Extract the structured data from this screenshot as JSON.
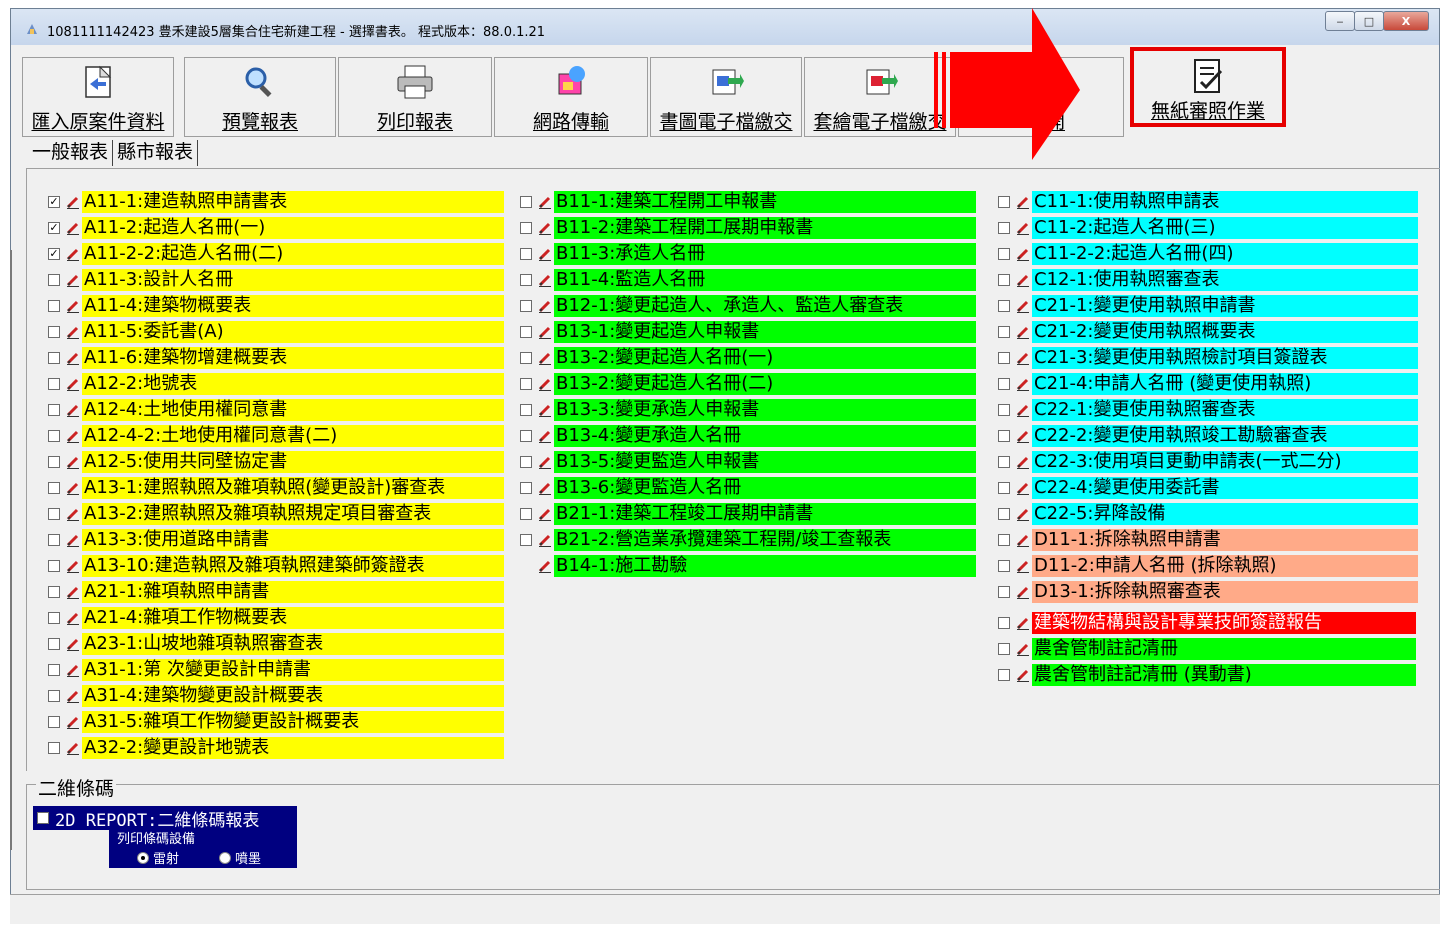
{
  "window": {
    "title": "1081111142423 豊禾建設5層集合住宅新建工程 - 選擇書表。  程式版本：88.0.1.21",
    "minimize": "‒",
    "maximize": "□",
    "close": "X"
  },
  "toolbar": [
    {
      "label": "匯入原案件資料"
    },
    {
      "label": "預覽報表"
    },
    {
      "label": "列印報表"
    },
    {
      "label": "網路傳輸"
    },
    {
      "label": "書圖電子檔繳交"
    },
    {
      "label": "套繪電子檔繳交"
    },
    {
      "label": "開"
    },
    {
      "label": "無紙審照作業"
    }
  ],
  "tabs": [
    "一般報表",
    "縣市報表"
  ],
  "columns": {
    "a": [
      {
        "label": "A11-1:建造執照申請書表",
        "checked": true
      },
      {
        "label": "A11-2:起造人名冊(一)",
        "checked": true
      },
      {
        "label": "A11-2-2:起造人名冊(二)",
        "checked": true
      },
      {
        "label": "A11-3:設計人名冊",
        "checked": false
      },
      {
        "label": "A11-4:建築物概要表",
        "checked": false
      },
      {
        "label": "A11-5:委託書(A)",
        "checked": false
      },
      {
        "label": "A11-6:建築物增建概要表",
        "checked": false
      },
      {
        "label": "A12-2:地號表",
        "checked": false
      },
      {
        "label": "A12-4:土地使用權同意書",
        "checked": false
      },
      {
        "label": "A12-4-2:土地使用權同意書(二)",
        "checked": false
      },
      {
        "label": "A12-5:使用共同壁協定書",
        "checked": false
      },
      {
        "label": "A13-1:建照執照及雜項執照(變更設計)審查表",
        "checked": false
      },
      {
        "label": "A13-2:建照執照及雜項執照規定項目審查表",
        "checked": false
      },
      {
        "label": "A13-3:使用道路申請書",
        "checked": false
      },
      {
        "label": "A13-10:建造執照及雜項執照建築師簽證表",
        "checked": false
      },
      {
        "label": "A21-1:雜項執照申請書",
        "checked": false
      },
      {
        "label": "A21-4:雜項工作物概要表",
        "checked": false
      },
      {
        "label": "A23-1:山坡地雜項執照審查表",
        "checked": false
      },
      {
        "label": "A31-1:第 次變更設計申請書",
        "checked": false
      },
      {
        "label": "A31-4:建築物變更設計概要表",
        "checked": false
      },
      {
        "label": "A31-5:雜項工作物變更設計概要表",
        "checked": false
      },
      {
        "label": "A32-2:變更設計地號表",
        "checked": false
      }
    ],
    "b": [
      {
        "label": "B11-1:建築工程開工申報書",
        "checkbox": true
      },
      {
        "label": "B11-2:建築工程開工展期申報書",
        "checkbox": true
      },
      {
        "label": "B11-3:承造人名冊",
        "checkbox": true
      },
      {
        "label": "B11-4:監造人名冊",
        "checkbox": true
      },
      {
        "label": "B12-1:變更起造人、承造人、監造人審查表",
        "checkbox": true
      },
      {
        "label": "B13-1:變更起造人申報書",
        "checkbox": true
      },
      {
        "label": "B13-2:變更起造人名冊(一)",
        "checkbox": true
      },
      {
        "label": "B13-2:變更起造人名冊(二)",
        "checkbox": true
      },
      {
        "label": "B13-3:變更承造人申報書",
        "checkbox": true
      },
      {
        "label": "B13-4:變更承造人名冊",
        "checkbox": true
      },
      {
        "label": "B13-5:變更監造人申報書",
        "checkbox": true
      },
      {
        "label": "B13-6:變更監造人名冊",
        "checkbox": true
      },
      {
        "label": "B21-1:建築工程竣工展期申請書",
        "checkbox": true
      },
      {
        "label": "B21-2:營造業承攬建築工程開/竣工查報表",
        "checkbox": true
      },
      {
        "label": "B14-1:施工勘驗",
        "checkbox": false
      }
    ],
    "c": [
      {
        "label": "C11-1:使用執照申請表",
        "color": "c"
      },
      {
        "label": "C11-2:起造人名冊(三)",
        "color": "c"
      },
      {
        "label": "C11-2-2:起造人名冊(四)",
        "color": "c"
      },
      {
        "label": "C12-1:使用執照審查表",
        "color": "c"
      },
      {
        "label": "C21-1:變更使用執照申請書",
        "color": "c"
      },
      {
        "label": "C21-2:變更使用執照概要表",
        "color": "c"
      },
      {
        "label": "C21-3:變更使用執照檢討項目簽證表",
        "color": "c"
      },
      {
        "label": "C21-4:申請人名冊 (變更使用執照)",
        "color": "c"
      },
      {
        "label": "C22-1:變更使用執照審查表",
        "color": "c"
      },
      {
        "label": "C22-2:變更使用執照竣工勘驗審查表",
        "color": "c"
      },
      {
        "label": "C22-3:使用項目更動申請表(一式二分)",
        "color": "c"
      },
      {
        "label": "C22-4:變更使用委託書",
        "color": "c"
      },
      {
        "label": "C22-5:昇降設備",
        "color": "c"
      },
      {
        "label": "D11-1:拆除執照申請書",
        "color": "s"
      },
      {
        "label": "D11-2:申請人名冊 (拆除執照)",
        "color": "s"
      },
      {
        "label": "D13-1:拆除執照審查表",
        "color": "s"
      }
    ],
    "extra": [
      {
        "label": "建築物結構與設計專業技師簽證報告",
        "color": "r"
      },
      {
        "label": "農舍管制註記清冊",
        "color": "g"
      },
      {
        "label": "農舍管制註記清冊 (異動書)",
        "color": "g"
      }
    ]
  },
  "qrcode": {
    "group_title": "二維條碼",
    "report_label": "2D REPORT:二維條碼報表",
    "device_title": "列印條碼設備",
    "options": [
      "雷射",
      "噴墨"
    ],
    "selected": "雷射"
  }
}
